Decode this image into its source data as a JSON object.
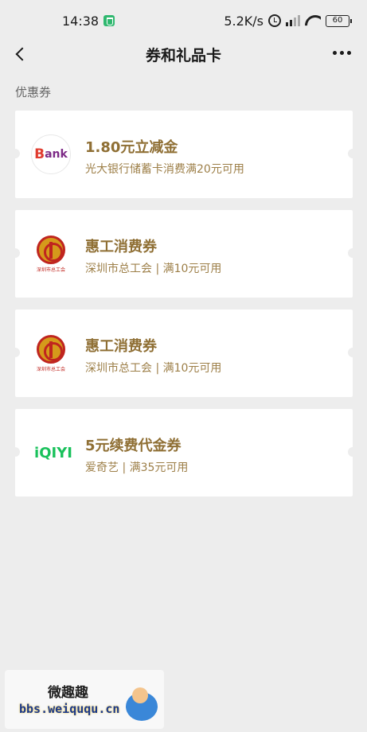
{
  "status_bar": {
    "time": "14:38",
    "network_speed": "5.2K/s",
    "battery": "60",
    "icons": [
      "shield-icon",
      "alarm-icon",
      "hd-icon",
      "signal-icon",
      "wifi-icon",
      "battery-icon"
    ]
  },
  "nav": {
    "title": "券和礼品卡",
    "back_icon": "chevron-left-icon",
    "more_icon": "more-dots-icon"
  },
  "section": {
    "label": "优惠券"
  },
  "coupons": [
    {
      "title": "1.80元立减金",
      "subtitle": "光大银行储蓄卡消费满20元可用",
      "logo": "bank-logo",
      "logo_text": "Bank"
    },
    {
      "title": "惠工消费券",
      "subtitle": "深圳市总工会 | 满10元可用",
      "logo": "trade-union-logo",
      "logo_text": "深圳市总工会"
    },
    {
      "title": "惠工消费券",
      "subtitle": "深圳市总工会 | 满10元可用",
      "logo": "trade-union-logo",
      "logo_text": "深圳市总工会"
    },
    {
      "title": "5元续费代金券",
      "subtitle": "爱奇艺 | 满35元可用",
      "logo": "iqiyi-logo",
      "logo_text": "iQIYI"
    }
  ],
  "watermark": {
    "name": "微趣趣",
    "url": "bbs.weiququ.cn"
  },
  "colors": {
    "background": "#ededed",
    "coupon_title": "#8f6f34",
    "coupon_subtitle": "#9d7f48",
    "iqiyi_green": "#19c15b"
  }
}
